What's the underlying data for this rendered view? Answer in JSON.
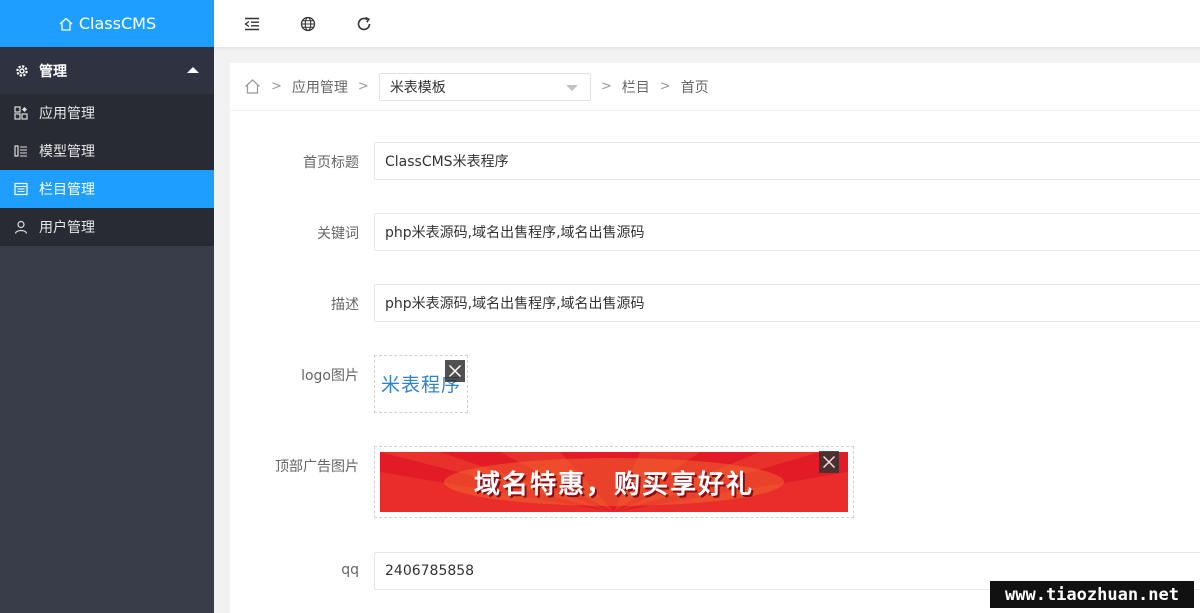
{
  "app": {
    "title": "ClassCMS",
    "brand_color": "#1e9fff"
  },
  "sidebar": {
    "group_label": "管理",
    "items": [
      {
        "label": "应用管理",
        "icon": "app-icon"
      },
      {
        "label": "模型管理",
        "icon": "model-icon"
      },
      {
        "label": "栏目管理",
        "icon": "column-icon",
        "active": true
      },
      {
        "label": "用户管理",
        "icon": "user-icon"
      }
    ]
  },
  "topbar": {
    "icons": [
      "collapse-menu-icon",
      "globe-icon",
      "refresh-icon"
    ]
  },
  "breadcrumb": {
    "home_icon": "home-icon",
    "app_manage": "应用管理",
    "template_selected": "米表模板",
    "column": "栏目",
    "current": "首页",
    "separator": ">"
  },
  "form": {
    "title_label": "首页标题",
    "title_value": "ClassCMS米表程序",
    "keywords_label": "关键词",
    "keywords_value": "php米表源码,域名出售程序,域名出售源码",
    "desc_label": "描述",
    "desc_value": "php米表源码,域名出售程序,域名出售源码",
    "logo_label": "logo图片",
    "logo_text": "米表程序",
    "ad_label": "顶部广告图片",
    "ad_text": "域名特惠，购买享好礼",
    "qq_label": "qq",
    "qq_value": "2406785858"
  },
  "watermark": "www.tiaozhuan.net"
}
